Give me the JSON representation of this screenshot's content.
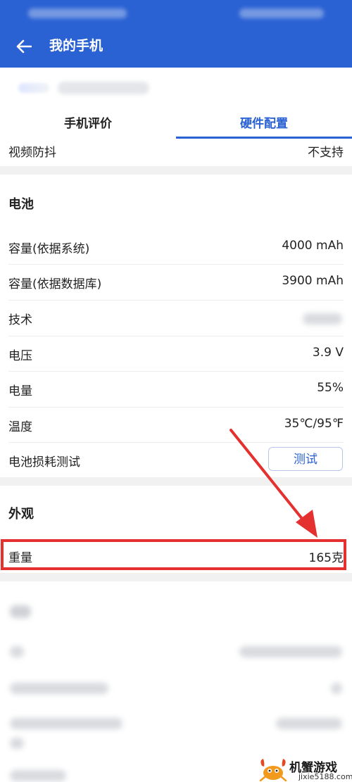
{
  "header": {
    "title": "我的手机",
    "color": "#2b62d3"
  },
  "tabs": [
    {
      "label": "手机评价",
      "active": false
    },
    {
      "label": "硬件配置",
      "active": true
    }
  ],
  "top_row": {
    "label": "视频防抖",
    "value": "不支持"
  },
  "battery": {
    "title": "电池",
    "rows": [
      {
        "label": "容量(依据系统)",
        "value": "4000 mAh"
      },
      {
        "label": "容量(依据数据库)",
        "value": "3900 mAh"
      },
      {
        "label": "技术",
        "value": ""
      },
      {
        "label": "电压",
        "value": "3.9 V"
      },
      {
        "label": "电量",
        "value": "55%"
      },
      {
        "label": "温度",
        "value": "35℃/95℉"
      },
      {
        "label": "电池损耗测试",
        "button": "测试"
      }
    ]
  },
  "appearance": {
    "title": "外观",
    "rows": [
      {
        "label": "重量",
        "value": "165克"
      }
    ]
  },
  "annotation": {
    "highlight_color": "#e53030"
  },
  "watermark": {
    "brand": "机蟹游戏",
    "url": "jixie5188.com"
  }
}
